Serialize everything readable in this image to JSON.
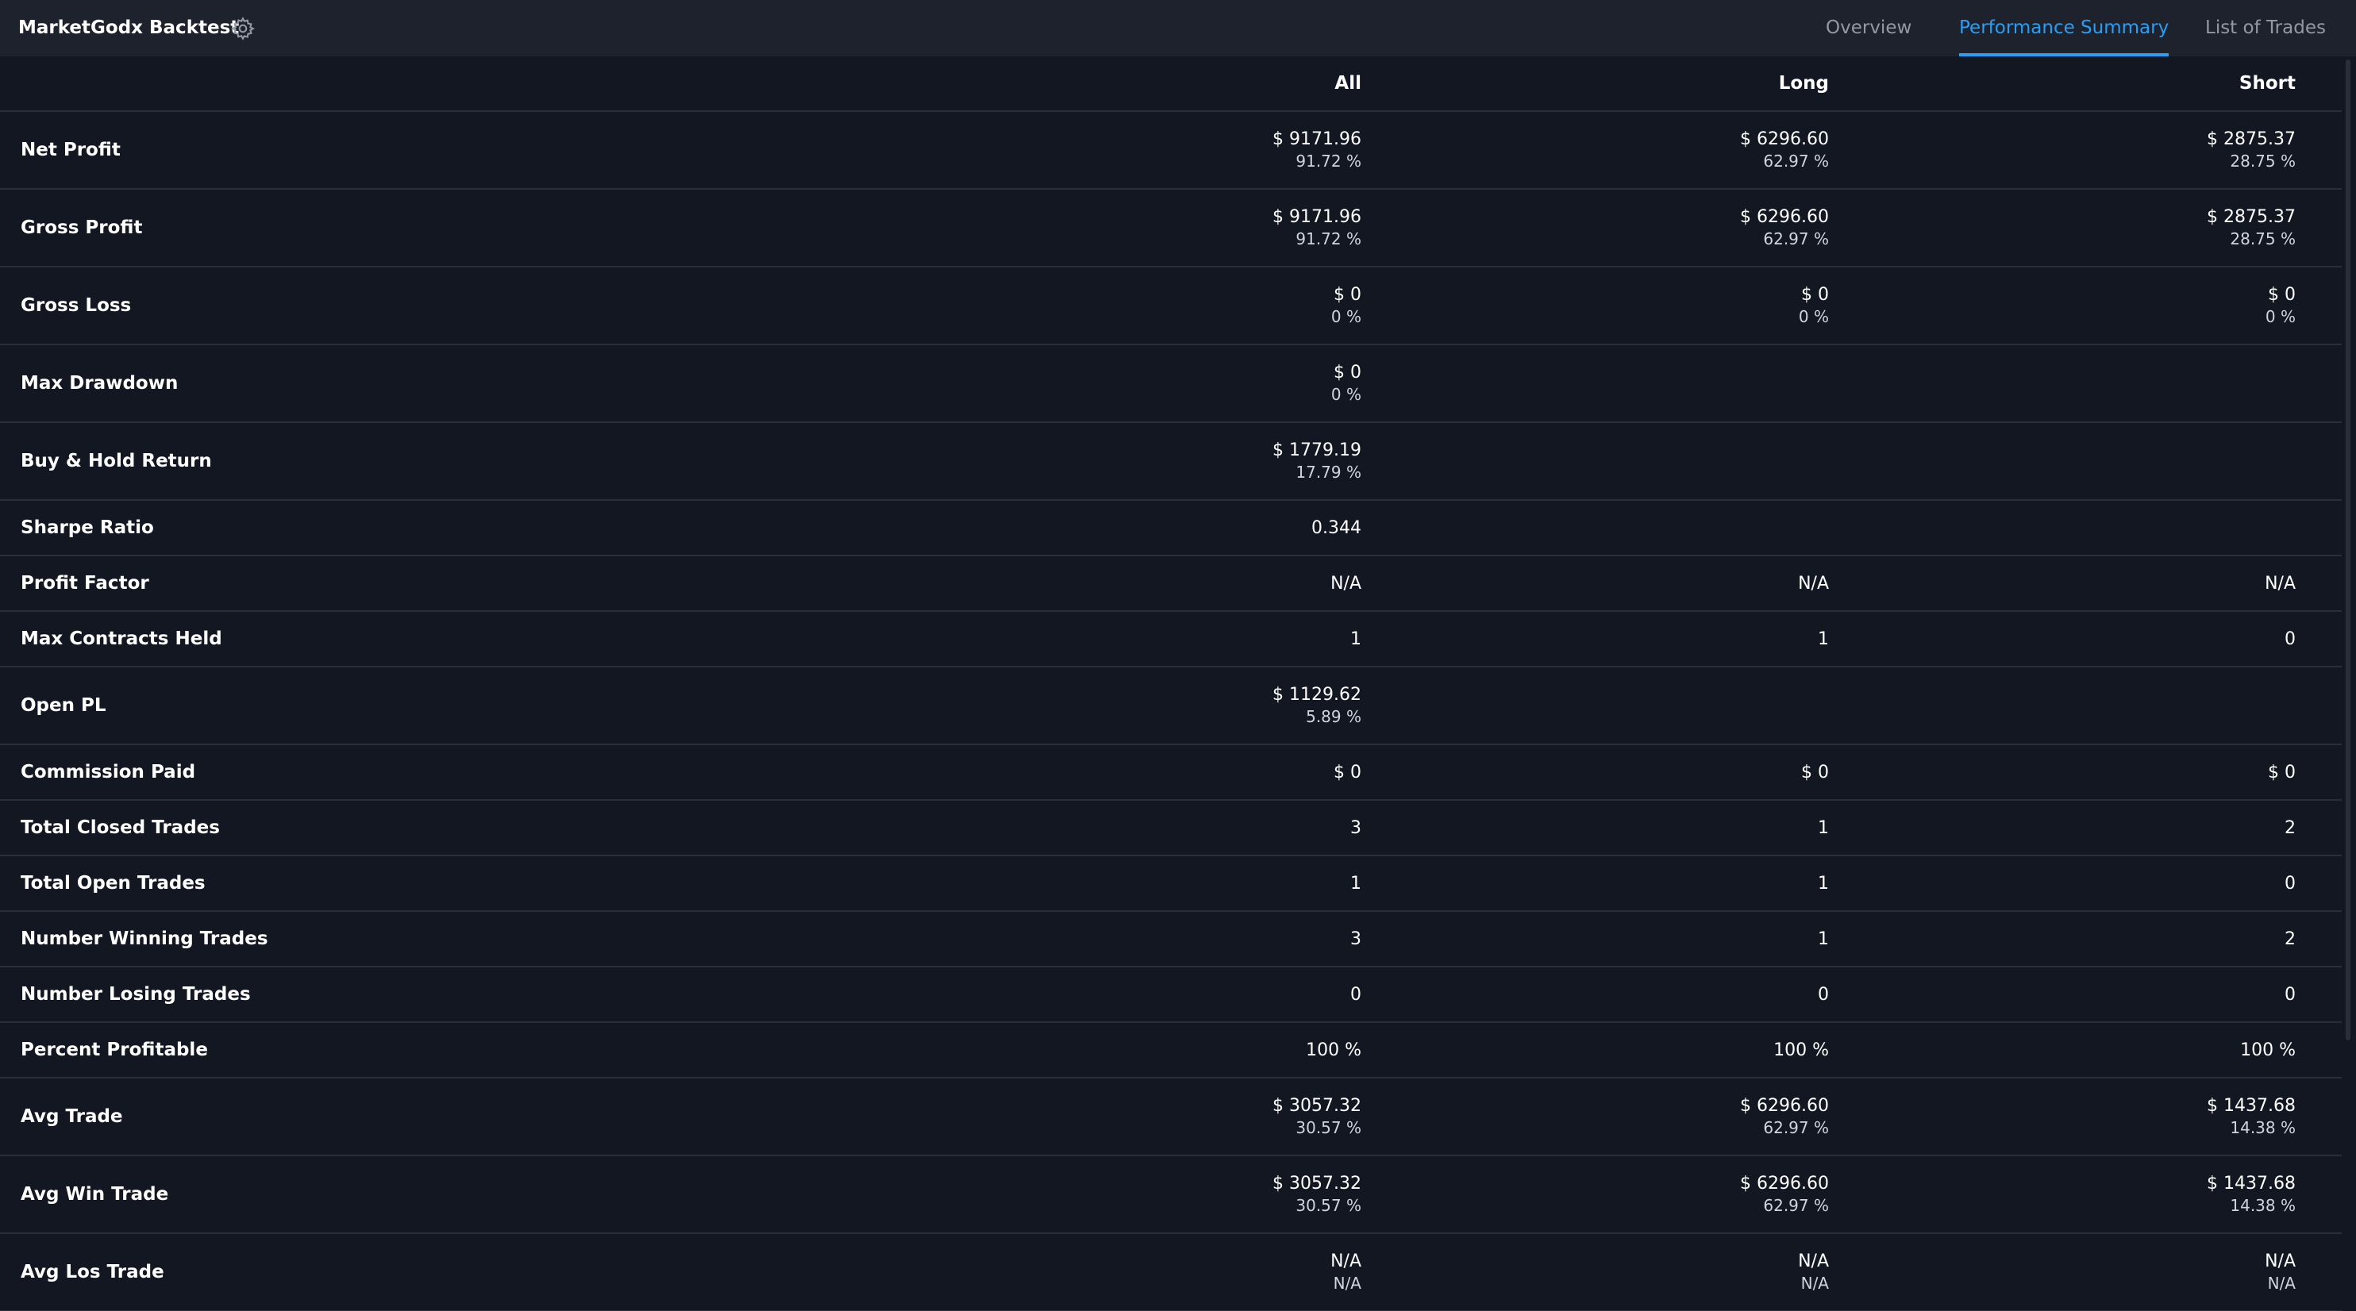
{
  "header": {
    "title": "MarketGodx Backtest",
    "settings_icon": "gear-icon",
    "tabs": [
      {
        "label": "Overview",
        "active": false
      },
      {
        "label": "Performance Summary",
        "active": true
      },
      {
        "label": "List of Trades",
        "active": false
      }
    ],
    "accent_color": "#2a9df4"
  },
  "table": {
    "columns": {
      "all": "All",
      "long": "Long",
      "short": "Short"
    },
    "rows": [
      {
        "label": "Net Profit",
        "all": [
          "$ 9171.96",
          "91.72 %"
        ],
        "long": [
          "$ 6296.60",
          "62.97 %"
        ],
        "short": [
          "$ 2875.37",
          "28.75 %"
        ]
      },
      {
        "label": "Gross Profit",
        "all": [
          "$ 9171.96",
          "91.72 %"
        ],
        "long": [
          "$ 6296.60",
          "62.97 %"
        ],
        "short": [
          "$ 2875.37",
          "28.75 %"
        ]
      },
      {
        "label": "Gross Loss",
        "all": [
          "$ 0",
          "0 %"
        ],
        "long": [
          "$ 0",
          "0 %"
        ],
        "short": [
          "$ 0",
          "0 %"
        ]
      },
      {
        "label": "Max Drawdown",
        "all": [
          "$ 0",
          "0 %"
        ],
        "long": [],
        "short": []
      },
      {
        "label": "Buy & Hold Return",
        "all": [
          "$ 1779.19",
          "17.79 %"
        ],
        "long": [],
        "short": []
      },
      {
        "label": "Sharpe Ratio",
        "all": [
          "0.344"
        ],
        "long": [],
        "short": []
      },
      {
        "label": "Profit Factor",
        "all": [
          "N/A"
        ],
        "long": [
          "N/A"
        ],
        "short": [
          "N/A"
        ]
      },
      {
        "label": "Max Contracts Held",
        "all": [
          "1"
        ],
        "long": [
          "1"
        ],
        "short": [
          "0"
        ]
      },
      {
        "label": "Open PL",
        "all": [
          "$ 1129.62",
          "5.89 %"
        ],
        "long": [],
        "short": []
      },
      {
        "label": "Commission Paid",
        "all": [
          "$ 0"
        ],
        "long": [
          "$ 0"
        ],
        "short": [
          "$ 0"
        ]
      },
      {
        "label": "Total Closed Trades",
        "all": [
          "3"
        ],
        "long": [
          "1"
        ],
        "short": [
          "2"
        ]
      },
      {
        "label": "Total Open Trades",
        "all": [
          "1"
        ],
        "long": [
          "1"
        ],
        "short": [
          "0"
        ]
      },
      {
        "label": "Number Winning Trades",
        "all": [
          "3"
        ],
        "long": [
          "1"
        ],
        "short": [
          "2"
        ]
      },
      {
        "label": "Number Losing Trades",
        "all": [
          "0"
        ],
        "long": [
          "0"
        ],
        "short": [
          "0"
        ]
      },
      {
        "label": "Percent Profitable",
        "all": [
          "100 %"
        ],
        "long": [
          "100 %"
        ],
        "short": [
          "100 %"
        ]
      },
      {
        "label": "Avg Trade",
        "all": [
          "$ 3057.32",
          "30.57 %"
        ],
        "long": [
          "$ 6296.60",
          "62.97 %"
        ],
        "short": [
          "$ 1437.68",
          "14.38 %"
        ]
      },
      {
        "label": "Avg Win Trade",
        "all": [
          "$ 3057.32",
          "30.57 %"
        ],
        "long": [
          "$ 6296.60",
          "62.97 %"
        ],
        "short": [
          "$ 1437.68",
          "14.38 %"
        ]
      },
      {
        "label": "Avg Los Trade",
        "all": [
          "N/A",
          "N/A"
        ],
        "long": [
          "N/A",
          "N/A"
        ],
        "short": [
          "N/A",
          "N/A"
        ]
      }
    ]
  }
}
